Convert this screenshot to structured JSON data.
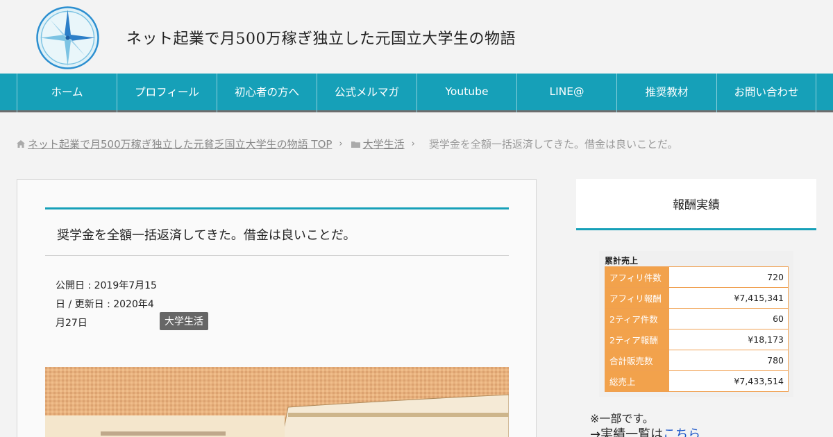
{
  "header": {
    "site_title": "ネット起業で月500万稼ぎ独立した元国立大学生の物語",
    "logo_icon": "compass-logo-icon"
  },
  "nav": {
    "items": [
      {
        "label": "ホーム"
      },
      {
        "label": "プロフィール"
      },
      {
        "label": "初心者の方へ"
      },
      {
        "label": "公式メルマガ"
      },
      {
        "label": "Youtube"
      },
      {
        "label": "LINE@"
      },
      {
        "label": "推奨教材"
      },
      {
        "label": "お問い合わせ"
      }
    ],
    "accent_color": "#16a0b8"
  },
  "breadcrumb": {
    "home_label": "ネット起業で月500万稼ぎ独立した元貧乏国立大学生の物語 TOP",
    "category_label": "大学生活",
    "current_label": "奨学金を全額一括返済してきた。借金は良いことだ。"
  },
  "article": {
    "title": "奨学金を全額一括返済してきた。借金は良いことだ。",
    "published": "公開日 : 2019年7月15",
    "published_cont": "日 / 更新日 : 2020年4",
    "updated_cont": "月27日",
    "category_badge": "大学生活"
  },
  "sidebar": {
    "widget_title": "報酬実績",
    "earnings_title": "累計売上",
    "earnings_rows": [
      {
        "label": "アフィリ件数",
        "value": "720"
      },
      {
        "label": "アフィリ報酬",
        "value": "¥7,415,341"
      },
      {
        "label": "2ティア件数",
        "value": "60"
      },
      {
        "label": "2ティア報酬",
        "value": "¥18,173"
      },
      {
        "label": "合計販売数",
        "value": "780"
      },
      {
        "label": "総売上",
        "value": "¥7,433,514"
      }
    ],
    "note": "※一部です。",
    "more_prefix": "→実績一覧は",
    "more_link": "こちら"
  }
}
